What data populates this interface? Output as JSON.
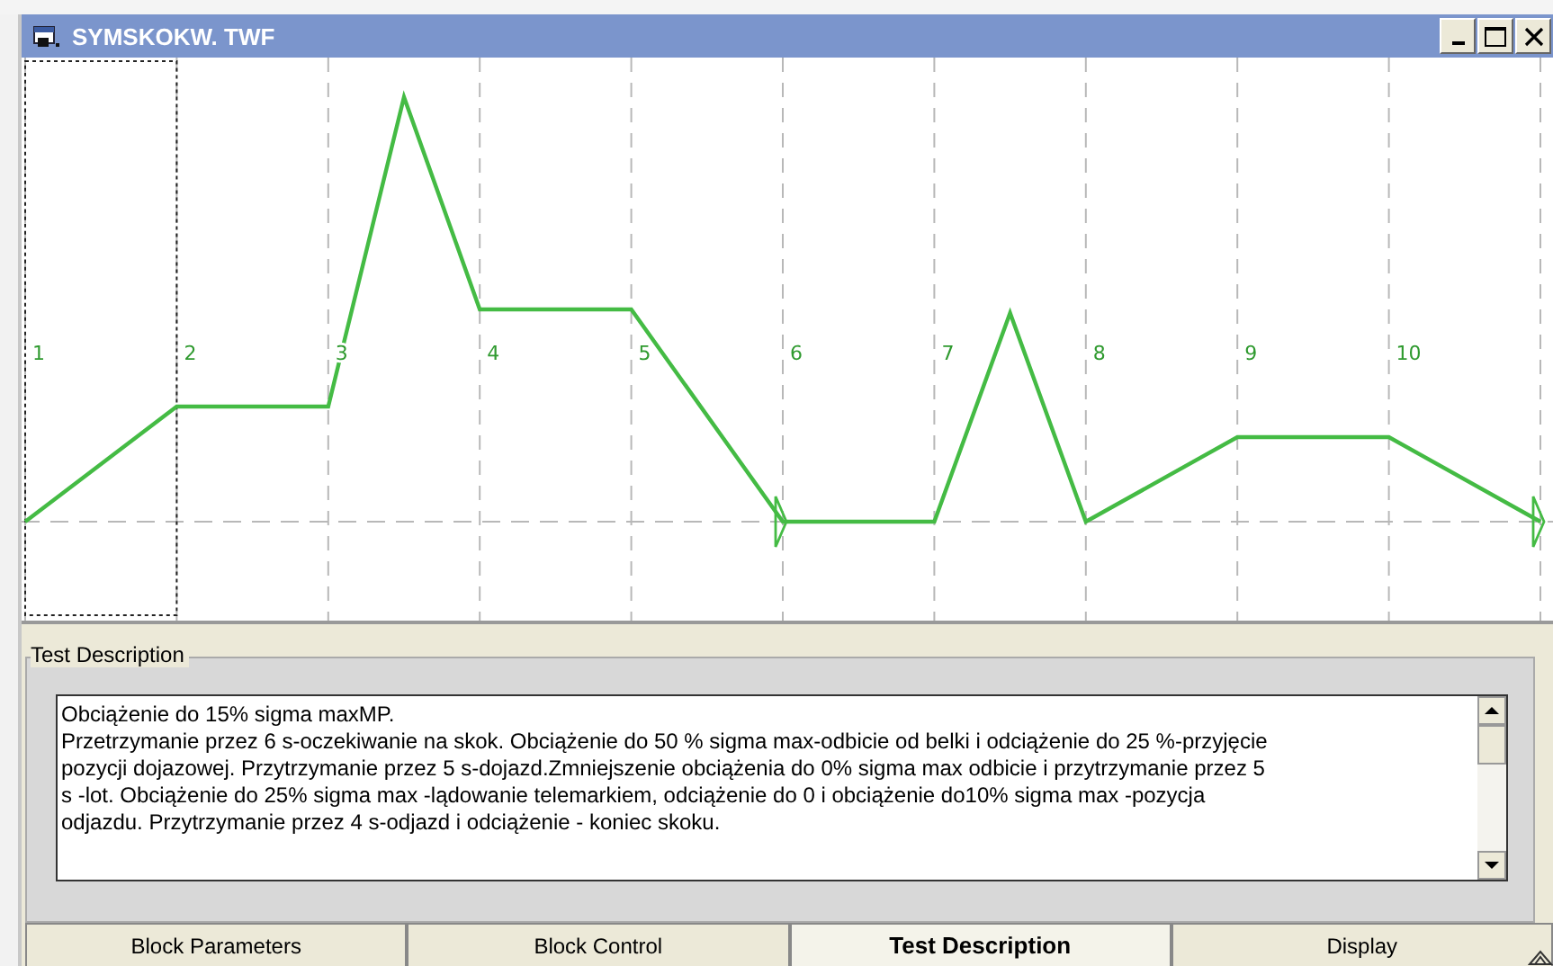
{
  "window": {
    "title": "SYMSKOKW. TWF"
  },
  "chart": {
    "blocks": [
      {
        "label": "1",
        "selected": true
      },
      {
        "label": "2",
        "selected": false
      },
      {
        "label": "3",
        "selected": false
      },
      {
        "label": "4",
        "selected": false
      },
      {
        "label": "5",
        "selected": false
      },
      {
        "label": "6",
        "selected": false
      },
      {
        "label": "7",
        "selected": false
      },
      {
        "label": "8",
        "selected": false
      },
      {
        "label": "9",
        "selected": false
      },
      {
        "label": "10",
        "selected": false
      }
    ]
  },
  "description": {
    "title": "Test Description",
    "lines": [
      "Obciążenie do 15% sigma maxMP.",
      "Przetrzymanie przez 6 s-oczekiwanie na skok. Obciążenie do 50 % sigma max-odbicie od belki i odciążenie do 25 %-przyjęcie",
      "pozycji dojazowej. Przytrzymanie przez 5 s-dojazd.Zmniejszenie obciążenia do 0% sigma max odbicie i przytrzymanie przez 5",
      "s -lot. Obciążenie do 25% sigma max -lądowanie telemarkiem, odciążenie do 0 i  obciążenie do10% sigma max -pozycja",
      "odjazdu. Przytrzymanie przez 4 s-odjazd i odciążenie - koniec skoku."
    ]
  },
  "tabs": [
    {
      "label": "Block Parameters",
      "selected": false
    },
    {
      "label": "Block Control",
      "selected": false
    },
    {
      "label": "Test Description",
      "selected": true
    },
    {
      "label": "Display",
      "selected": false
    }
  ]
}
